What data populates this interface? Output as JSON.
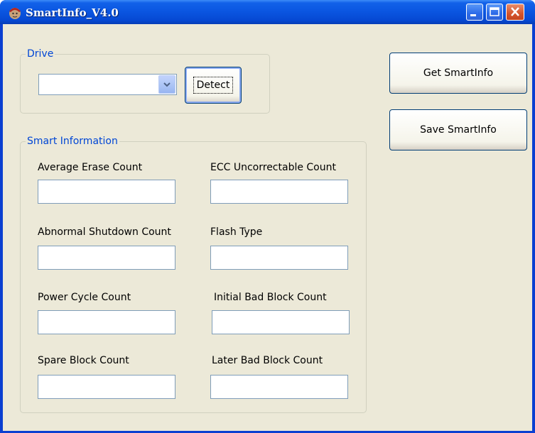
{
  "window": {
    "title": "SmartInfo_V4.0"
  },
  "title_buttons": {
    "minimize": "minimize-icon",
    "maximize": "maximize-icon",
    "close": "close-icon"
  },
  "drive_group": {
    "title": "Drive",
    "drive_value": "",
    "detect_label": "Detect"
  },
  "actions": {
    "get_label": "Get SmartInfo",
    "save_label": "Save SmartInfo"
  },
  "smart_group": {
    "title": "Smart Information",
    "fields": [
      {
        "label": "Average Erase Count",
        "value": ""
      },
      {
        "label": "ECC Uncorrectable Count",
        "value": ""
      },
      {
        "label": "Abnormal Shutdown Count",
        "value": ""
      },
      {
        "label": "Flash Type",
        "value": ""
      },
      {
        "label": "Power Cycle Count",
        "value": ""
      },
      {
        "label": "Initial Bad Block Count",
        "value": ""
      },
      {
        "label": "Spare Block Count",
        "value": ""
      },
      {
        "label": "Later Bad Block Count",
        "value": ""
      }
    ]
  },
  "colors": {
    "titlebar": "#0a55e0",
    "client_bg": "#ece9d8",
    "group_title": "#0046d5",
    "field_border": "#7f9db9"
  }
}
